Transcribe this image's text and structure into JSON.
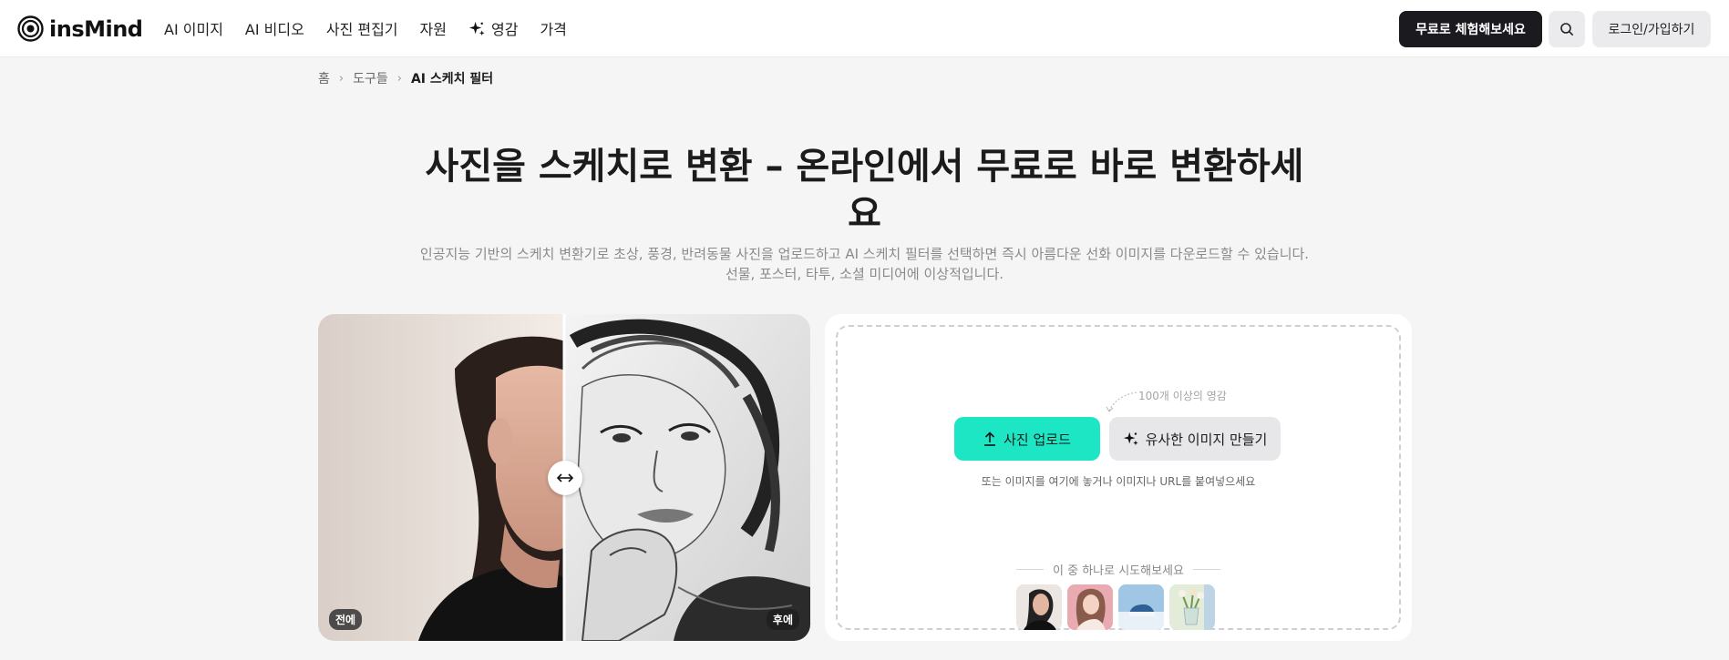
{
  "header": {
    "logo_text": "insMind",
    "nav": [
      {
        "label": "AI 이미지"
      },
      {
        "label": "AI 비디오"
      },
      {
        "label": "사진 편집기"
      },
      {
        "label": "자원"
      },
      {
        "label": "영감",
        "icon": "sparkle-icon"
      },
      {
        "label": "가격"
      }
    ],
    "trial_button": "무료로 체험해보세요",
    "search_icon": "search-icon",
    "login_button": "로그인/가입하기"
  },
  "breadcrumb": {
    "home": "홈",
    "tools": "도구들",
    "current": "AI 스케치 필터"
  },
  "hero": {
    "title": "사진을 스케치로 변환 – 온라인에서 무료로 바로 변환하세요",
    "subtitle": "인공지능 기반의 스케치 변환기로 초상, 풍경, 반려동물 사진을 업로드하고 AI 스케치 필터를 선택하면 즉시 아름다운 선화 이미지를 다운로드할 수 있습니다. 선물, 포스터, 타투, 소셜 미디어에 이상적입니다."
  },
  "compare": {
    "before_label": "전에",
    "after_label": "후에",
    "split_percent": 50
  },
  "upload": {
    "inspiration_note": "100개 이상의 영감",
    "upload_button": "사진 업로드",
    "similar_button": "유사한 이미지 만들기",
    "drop_hint": "또는 이미지를 여기에 놓거나 이미지나 URL를 붙여넣으세요",
    "try_label": "이 중 하나로 시도해보세요",
    "samples": [
      "portrait-sample",
      "pink-portrait-sample",
      "snow-car-sample",
      "flower-vase-sample"
    ]
  },
  "colors": {
    "accent": "#1de6c4",
    "dark_button": "#1b1b1f",
    "page_bg": "#f5f5f6"
  }
}
